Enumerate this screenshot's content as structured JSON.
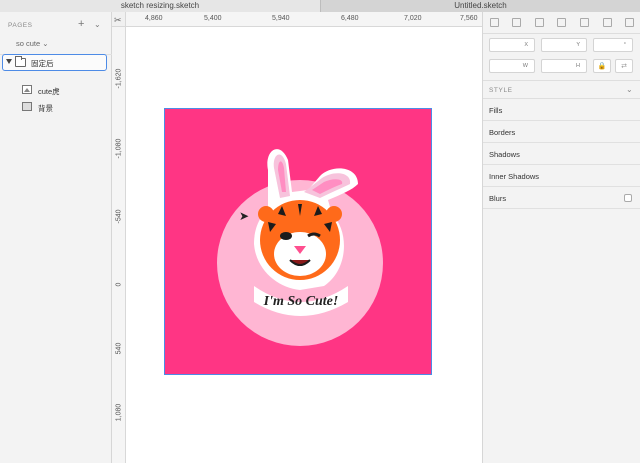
{
  "tabs": [
    {
      "label": "sketch resizing.sketch"
    },
    {
      "label": "Untitled.sketch"
    }
  ],
  "sidebar": {
    "pages_title": "PAGES",
    "add_icon": "plus-icon",
    "collapse_icon": "chevron-down-icon",
    "current_page": "so cute ⌄",
    "layers": [
      {
        "label": "固定后",
        "type": "group"
      },
      {
        "label": "cute虎",
        "type": "image"
      },
      {
        "label": "背景",
        "type": "rectangle"
      }
    ]
  },
  "ruler": {
    "top": [
      "4,860",
      "5,400",
      "5,940",
      "6,480",
      "7,020",
      "7,560"
    ],
    "left": [
      "-1,620",
      "-1,080",
      "-540",
      "0",
      "540",
      "1,080"
    ]
  },
  "inspector": {
    "fields": {
      "x": "X",
      "y": "Y",
      "rotate": "°",
      "w": "W",
      "h": "H"
    },
    "style_header": "STYLE",
    "sections": [
      "Fills",
      "Borders",
      "Shadows",
      "Inner Shadows",
      "Blurs"
    ]
  },
  "artwork": {
    "text": "I'm So Cute!",
    "bg_color": "#ff3584",
    "circle_color": "#ffb6d3"
  }
}
